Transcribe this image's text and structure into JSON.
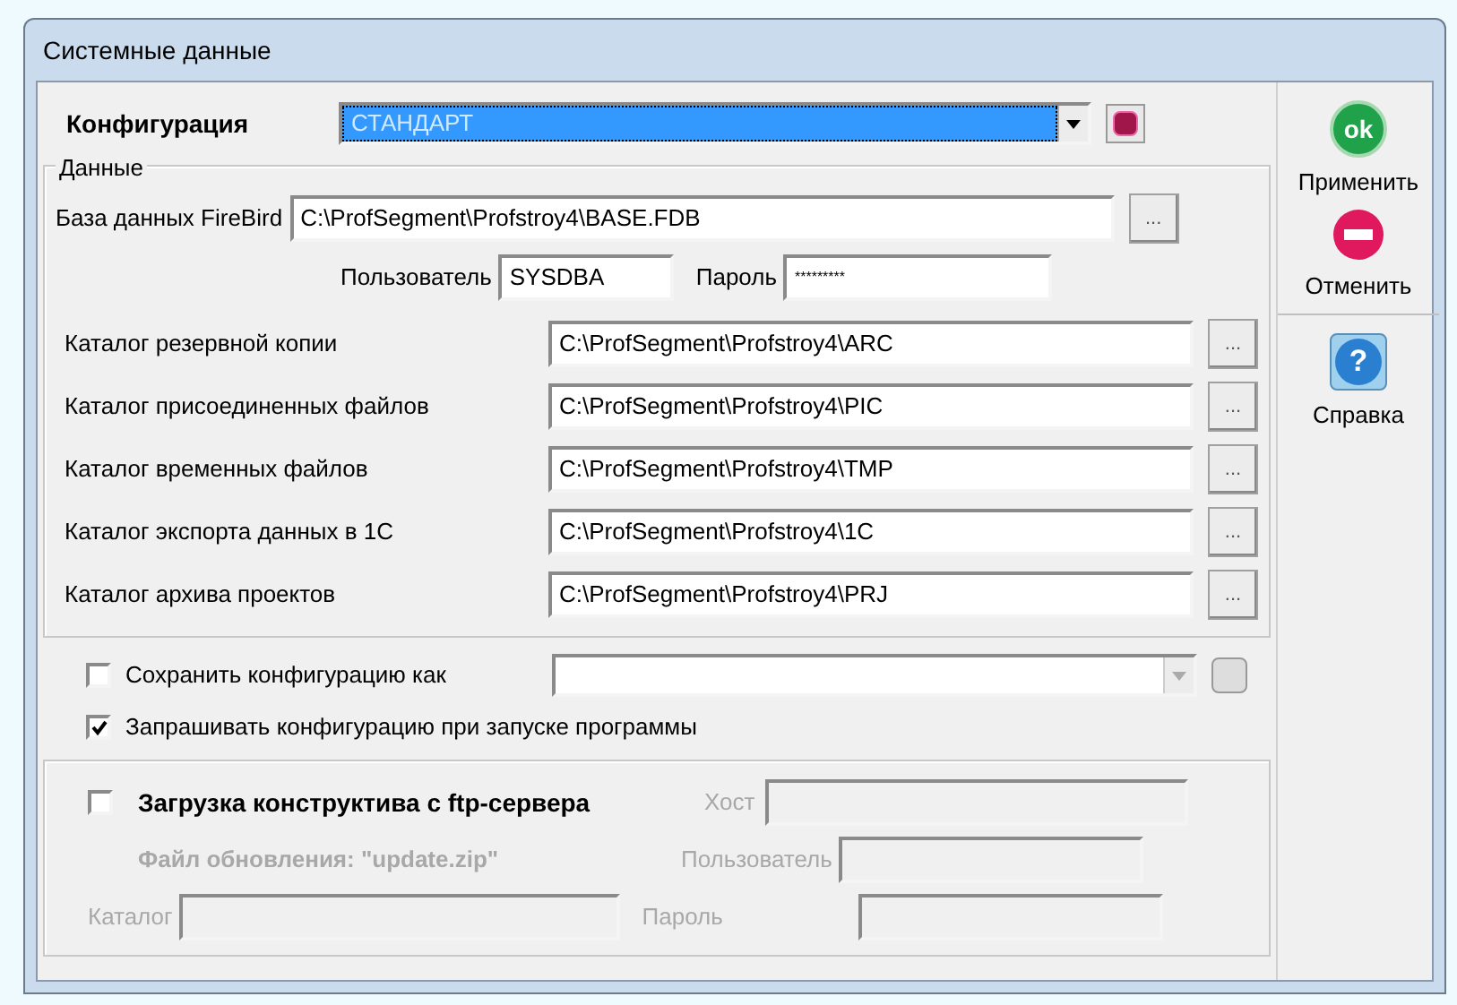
{
  "window": {
    "title": "Системные данные"
  },
  "configuration": {
    "label": "Конфигурация",
    "value": "СТАНДАРТ"
  },
  "data_group": {
    "title": "Данные",
    "database": {
      "label": "База данных FireBird",
      "value": "C:\\ProfSegment\\Profstroy4\\BASE.FDB",
      "browse": "..."
    },
    "user": {
      "label": "Пользователь",
      "value": "SYSDBA"
    },
    "password": {
      "label": "Пароль",
      "value": "*********"
    },
    "folders": [
      {
        "label": "Каталог резервной копии",
        "value": "C:\\ProfSegment\\Profstroy4\\ARC",
        "browse": "..."
      },
      {
        "label": "Каталог присоединенных файлов",
        "value": "C:\\ProfSegment\\Profstroy4\\PIC",
        "browse": "..."
      },
      {
        "label": "Каталог временных файлов",
        "value": "C:\\ProfSegment\\Profstroy4\\TMP",
        "browse": "..."
      },
      {
        "label": "Каталог экспорта данных в 1С",
        "value": "C:\\ProfSegment\\Profstroy4\\1C",
        "browse": "..."
      },
      {
        "label": "Каталог архива проектов",
        "value": "C:\\ProfSegment\\Profstroy4\\PRJ",
        "browse": "..."
      }
    ]
  },
  "save_config": {
    "label": "Сохранить конфигурацию как",
    "checked": false
  },
  "ask_config": {
    "label": "Запрашивать конфигурацию при запуске программы",
    "checked": true
  },
  "ftp": {
    "label": "Загрузка конструктива с ftp-сервера",
    "checked": false,
    "file_label": "Файл обновления: \"update.zip\"",
    "host_label": "Хост",
    "folder_label": "Каталог",
    "user_label": "Пользователь",
    "password_label": "Пароль"
  },
  "actions": [
    {
      "kind": "ok",
      "badge": "ok",
      "label": "Применить"
    },
    {
      "kind": "cancel",
      "label": "Отменить"
    },
    {
      "kind": "help",
      "badge": "?",
      "label": "Справка"
    }
  ]
}
